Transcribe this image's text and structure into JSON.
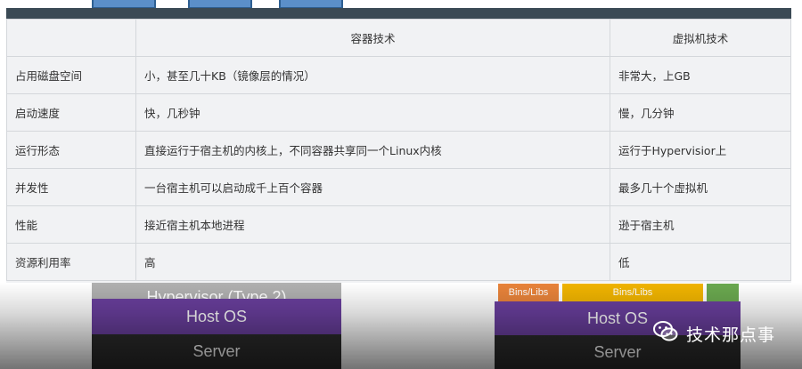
{
  "table": {
    "headers": [
      "",
      "容器技术",
      "虚拟机技术"
    ],
    "rows": [
      [
        "占用磁盘空间",
        "小，甚至几十KB（镜像层的情况）",
        "非常大，上GB"
      ],
      [
        "启动速度",
        "快，几秒钟",
        "慢，几分钟"
      ],
      [
        "运行形态",
        "直接运行于宿主机的内核上，不同容器共享同一个Linux内核",
        "运行于Hypervisior上"
      ],
      [
        "并发性",
        "一台宿主机可以启动成千上百个容器",
        "最多几十个虚拟机"
      ],
      [
        "性能",
        "接近宿主机本地进程",
        "逊于宿主机"
      ],
      [
        "资源利用率",
        "高",
        "低"
      ]
    ]
  },
  "background_diagram": {
    "left_stack": {
      "hypervisor_label": "Hypervisor (Type 2)",
      "host_os_label": "Host OS",
      "server_label": "Server"
    },
    "right_stack": {
      "bins_labels": [
        "Bins/Libs",
        "Bins/Libs"
      ],
      "host_os_label": "Host OS",
      "server_label": "Server"
    },
    "colors": {
      "host_os": "#6a3f9e",
      "server": "#2b2b2b",
      "hypervisor": "#b0b0b0",
      "bins_orange": "#e8833a",
      "bins_yellow": "#f0b400",
      "bins_green": "#6aa84f",
      "top_box": "#5b8fc9",
      "table_header_bar": "#3b4a55"
    }
  },
  "watermark": {
    "icon": "wechat-icon",
    "text": "技术那点事"
  }
}
